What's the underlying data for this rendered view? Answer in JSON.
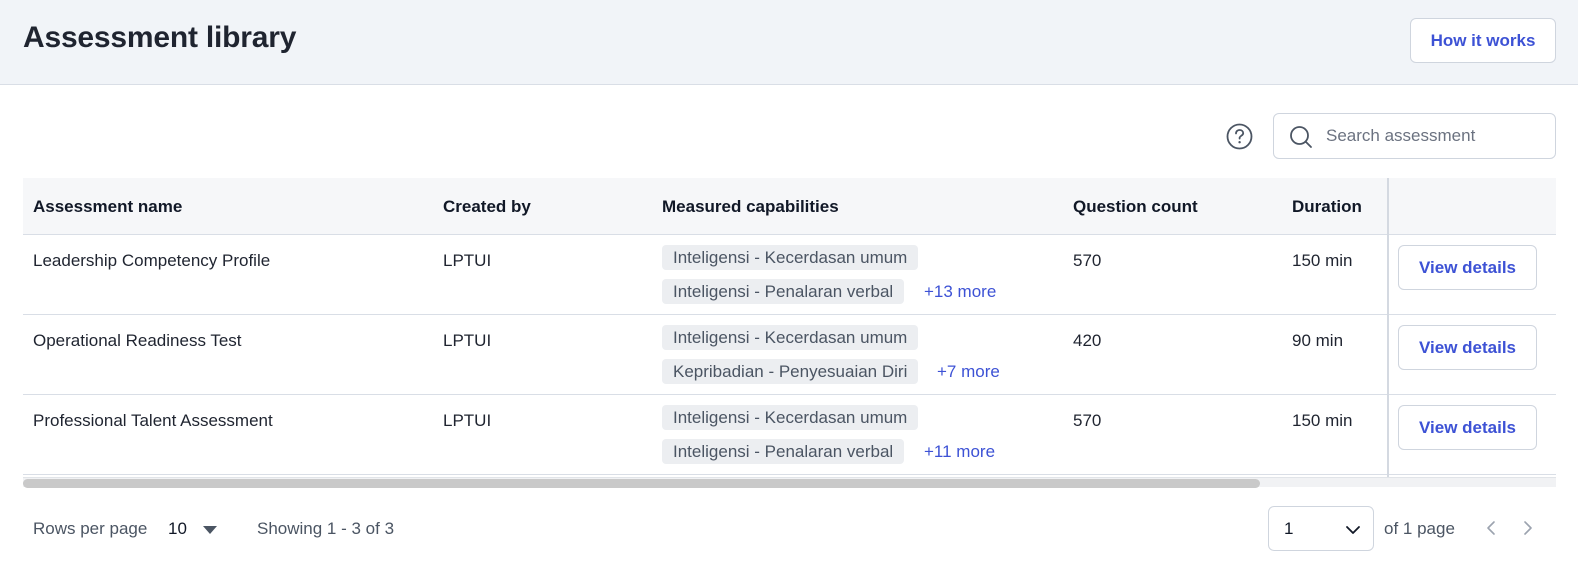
{
  "header": {
    "title": "Assessment library",
    "how_it_works_label": "How it works"
  },
  "search": {
    "placeholder": "Search assessment",
    "value": ""
  },
  "table": {
    "columns": [
      "Assessment name",
      "Created by",
      "Measured capabilities",
      "Question count",
      "Duration"
    ],
    "rows": [
      {
        "name": "Leadership Competency Profile",
        "created_by": "LPTUI",
        "capabilities": [
          "Inteligensi - Kecerdasan umum",
          "Inteligensi - Penalaran verbal"
        ],
        "more": "+13 more",
        "question_count": "570",
        "duration": "150 min",
        "action": "View details"
      },
      {
        "name": "Operational Readiness Test",
        "created_by": "LPTUI",
        "capabilities": [
          "Inteligensi - Kecerdasan umum",
          "Kepribadian - Penyesuaian Diri"
        ],
        "more": "+7 more",
        "question_count": "420",
        "duration": "90 min",
        "action": "View details"
      },
      {
        "name": "Professional Talent Assessment",
        "created_by": "LPTUI",
        "capabilities": [
          "Inteligensi - Kecerdasan umum",
          "Inteligensi - Penalaran verbal"
        ],
        "more": "+11 more",
        "question_count": "570",
        "duration": "150 min",
        "action": "View details"
      }
    ]
  },
  "horizontal_scroll": {
    "visible_fraction": 0.807,
    "position_fraction": 0
  },
  "footer": {
    "rows_per_page_label": "Rows per page",
    "rows_per_page_value": "10",
    "showing_text": "Showing 1 - 3 of 3",
    "page_value": "1",
    "page_total_text": "of 1 page"
  },
  "icons": {
    "help": "question-circle-icon",
    "search": "search-icon",
    "rows_dropdown": "caret-down-icon",
    "page_dropdown": "chevron-down-icon",
    "prev": "chevron-left-icon",
    "next": "chevron-right-icon"
  },
  "colors": {
    "accent": "#3d52d5",
    "header_bg": "#f1f4f8",
    "chip_bg": "#eceef1",
    "border": "#cfd5de"
  }
}
